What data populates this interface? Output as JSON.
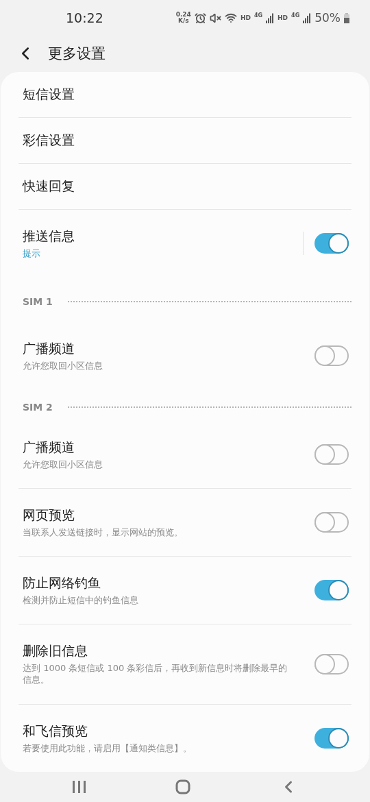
{
  "status_bar": {
    "time": "10:22",
    "speed_value": "0.24",
    "speed_unit": "K/s",
    "sim_labels": [
      {
        "hd": "HD",
        "net": "4G"
      },
      {
        "hd": "HD",
        "net": "4G"
      }
    ],
    "battery": "50%"
  },
  "header": {
    "title": "更多设置"
  },
  "items": [
    {
      "kind": "link",
      "title": "短信设置"
    },
    {
      "kind": "link",
      "title": "彩信设置"
    },
    {
      "kind": "link",
      "title": "快速回复"
    },
    {
      "kind": "split-switch",
      "title": "推送信息",
      "summary": "提示",
      "summary_accent": true,
      "on": true
    },
    {
      "kind": "section",
      "title": "SIM 1"
    },
    {
      "kind": "switch",
      "title": "广播频道",
      "summary": "允许您取回小区信息",
      "summary_accent": false,
      "on": false
    },
    {
      "kind": "section",
      "title": "SIM 2"
    },
    {
      "kind": "switch",
      "title": "广播频道",
      "summary": "允许您取回小区信息",
      "summary_accent": false,
      "on": false
    },
    {
      "kind": "switch",
      "title": "网页预览",
      "summary": "当联系人发送链接时，显示网站的预览。",
      "summary_accent": false,
      "on": false
    },
    {
      "kind": "switch",
      "title": "防止网络钓鱼",
      "summary": "检测并防止短信中的钓鱼信息",
      "summary_accent": false,
      "on": true
    },
    {
      "kind": "switch",
      "title": "删除旧信息",
      "summary": "达到 1000 条短信或 100 条彩信后，再收到新信息时将删除最早的信息。",
      "summary_accent": false,
      "on": false
    },
    {
      "kind": "switch",
      "title": "和飞信预览",
      "summary": "若要使用此功能，请启用【通知类信息】。",
      "summary_accent": false,
      "on": true
    }
  ]
}
